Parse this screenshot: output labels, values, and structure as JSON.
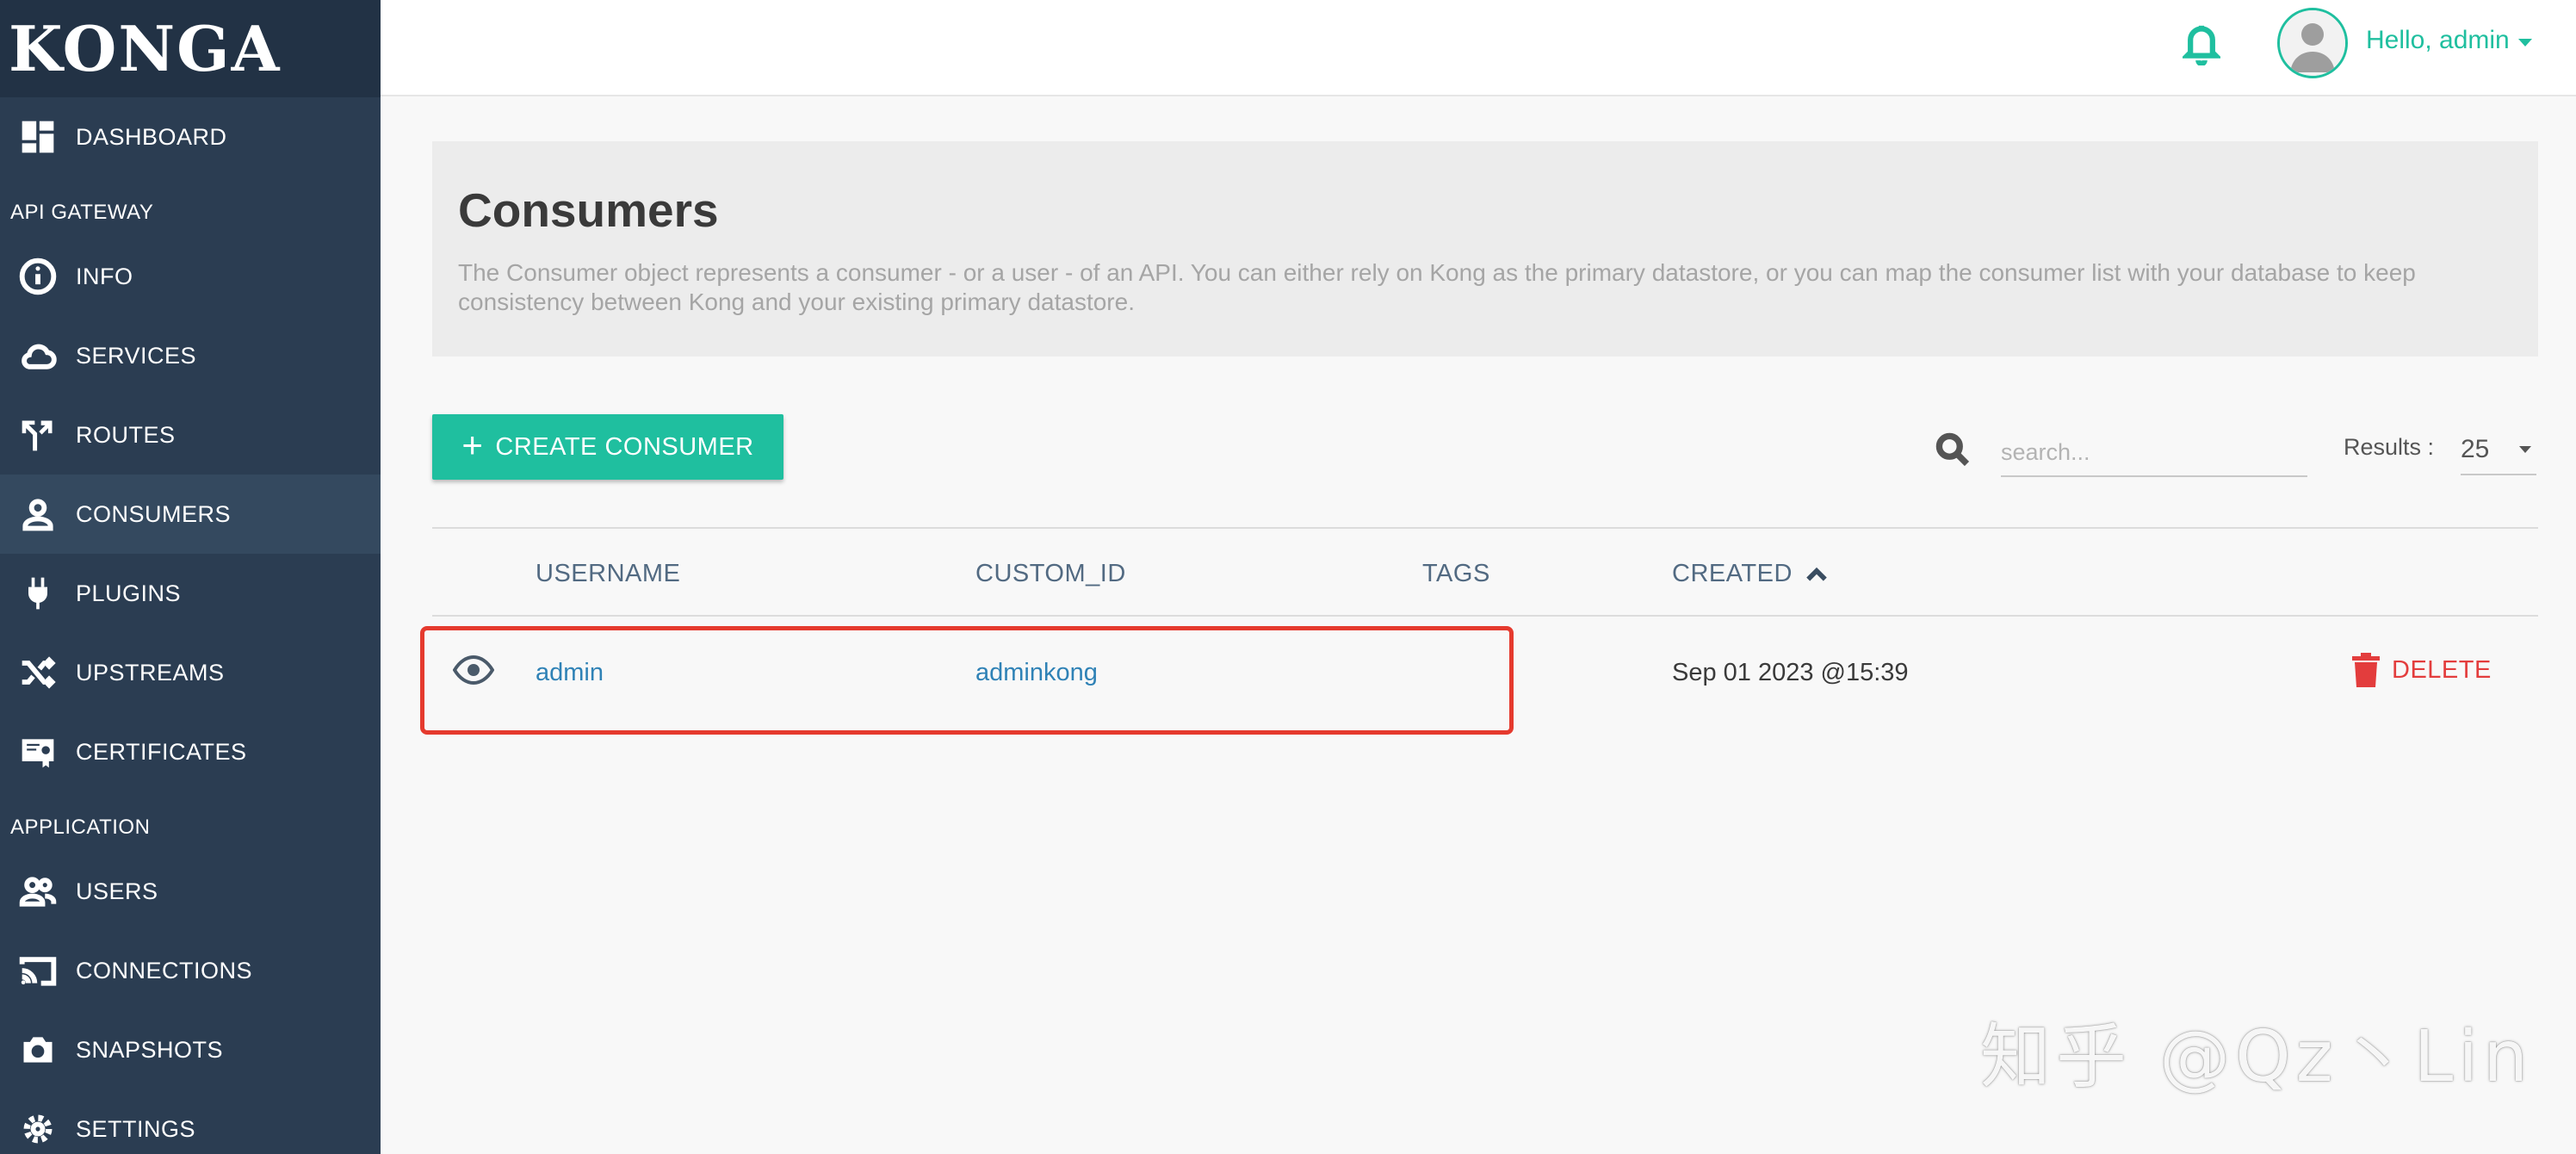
{
  "app": {
    "logo": "KONGA"
  },
  "sidebar": {
    "dashboard": "DASHBOARD",
    "sections": {
      "api_gateway": "API GATEWAY",
      "application": "APPLICATION"
    },
    "api_items": [
      {
        "label": "INFO",
        "icon": "info-icon"
      },
      {
        "label": "SERVICES",
        "icon": "cloud-icon"
      },
      {
        "label": "ROUTES",
        "icon": "fork-icon"
      },
      {
        "label": "CONSUMERS",
        "icon": "user-icon",
        "active": true
      },
      {
        "label": "PLUGINS",
        "icon": "plug-icon"
      },
      {
        "label": "UPSTREAMS",
        "icon": "shuffle-icon"
      },
      {
        "label": "CERTIFICATES",
        "icon": "certificate-icon"
      }
    ],
    "app_items": [
      {
        "label": "USERS",
        "icon": "users-icon"
      },
      {
        "label": "CONNECTIONS",
        "icon": "cast-icon"
      },
      {
        "label": "SNAPSHOTS",
        "icon": "camera-icon"
      },
      {
        "label": "SETTINGS",
        "icon": "gear-icon"
      }
    ]
  },
  "header": {
    "greeting": "Hello, admin",
    "accent": "#1fbf9f"
  },
  "hero": {
    "title": "Consumers",
    "description": "The Consumer object represents a consumer - or a user - of an API. You can either rely on Kong as the primary datastore, or you can map the consumer list with your database to keep consistency between Kong and your existing primary datastore."
  },
  "toolbar": {
    "create_label": "CREATE CONSUMER",
    "search_placeholder": "search...",
    "results_label": "Results :",
    "results_value": "25"
  },
  "table": {
    "columns": {
      "username": "USERNAME",
      "custom_id": "CUSTOM_ID",
      "tags": "TAGS",
      "created": "CREATED"
    },
    "rows": [
      {
        "username": "admin",
        "custom_id": "adminkong",
        "tags": "",
        "created": "Sep 01 2023 @15:39",
        "delete_label": "DELETE"
      }
    ]
  },
  "watermark": "知乎 @Qz丶Lin"
}
